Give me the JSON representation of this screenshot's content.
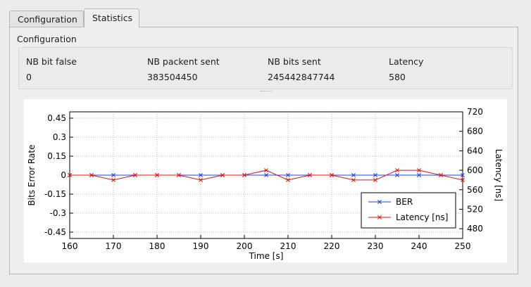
{
  "tabs": [
    {
      "label": "Configuration",
      "active": false
    },
    {
      "label": "Statistics",
      "active": true
    }
  ],
  "group": {
    "title": "Configuration",
    "headers": [
      "NB bit false",
      "NB packent sent",
      "NB bits sent",
      "Latency"
    ],
    "values": [
      "0",
      "383504450",
      "245442847744",
      "580"
    ]
  },
  "chart_data": {
    "type": "line",
    "xlabel": "Time [s]",
    "ylabel": "Bits Error Rate",
    "y2label": "Latency [ns]",
    "xlim": [
      160,
      250
    ],
    "ylim": [
      -0.5,
      0.5
    ],
    "y2lim": [
      460,
      720
    ],
    "x_ticks": [
      160,
      170,
      180,
      190,
      200,
      210,
      220,
      230,
      240,
      250
    ],
    "y_ticks": [
      -0.45,
      -0.3,
      -0.15,
      0,
      0.15,
      0.3,
      0.45
    ],
    "y_tick_labels": [
      "-0.45",
      "-0.3",
      "-0.15",
      "0",
      "0.15",
      "0.3",
      "0.45"
    ],
    "y2_ticks": [
      480,
      520,
      560,
      600,
      640,
      680,
      720
    ],
    "grid": true,
    "legend_position": "bottom-right",
    "series": [
      {
        "name": "BER",
        "axis": "left",
        "color": "#1f3fd0",
        "x": [
          160,
          165,
          170,
          175,
          180,
          185,
          190,
          195,
          200,
          205,
          210,
          215,
          220,
          225,
          230,
          235,
          240,
          245,
          250
        ],
        "y": [
          0,
          0,
          0,
          0,
          0,
          0,
          0,
          0,
          0,
          0,
          0,
          0,
          0,
          0,
          0,
          0,
          0,
          0,
          0
        ]
      },
      {
        "name": "Latency [ns]",
        "axis": "right",
        "color": "#e01010",
        "x": [
          160,
          165,
          170,
          175,
          180,
          185,
          190,
          195,
          200,
          205,
          210,
          215,
          220,
          225,
          230,
          235,
          240,
          245,
          250
        ],
        "y": [
          590,
          590,
          580,
          590,
          590,
          590,
          580,
          590,
          590,
          600,
          580,
          590,
          590,
          580,
          580,
          600,
          600,
          590,
          580
        ]
      }
    ]
  }
}
